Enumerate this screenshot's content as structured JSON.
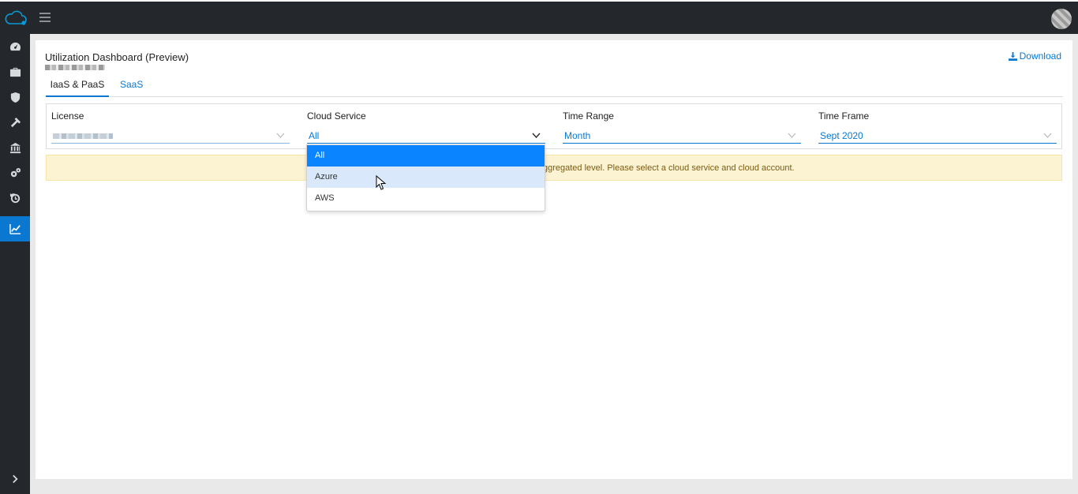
{
  "header": {
    "logo_icon": "cloud-logo-icon",
    "menu_icon": "hamburger-icon",
    "avatar": "user-avatar"
  },
  "sidebar": {
    "items": [
      {
        "name": "dashboard",
        "icon": "dashboard-icon"
      },
      {
        "name": "briefcase",
        "icon": "briefcase-icon"
      },
      {
        "name": "security",
        "icon": "shield-icon"
      },
      {
        "name": "tools",
        "icon": "hammer-icon"
      },
      {
        "name": "institution",
        "icon": "bank-icon"
      },
      {
        "name": "settings",
        "icon": "gears-icon"
      },
      {
        "name": "history",
        "icon": "history-icon"
      },
      {
        "name": "analytics",
        "icon": "chart-line-icon",
        "active": true
      }
    ],
    "expand_icon": "chevron-right-icon"
  },
  "page": {
    "title": "Utilization Dashboard (Preview)",
    "download_label": "Download"
  },
  "tabs": [
    {
      "label": "IaaS & PaaS",
      "active": true
    },
    {
      "label": "SaaS",
      "active": false
    }
  ],
  "filters": {
    "license": {
      "label": "License",
      "value": ""
    },
    "cloud_service": {
      "label": "Cloud Service",
      "value": "All"
    },
    "time_range": {
      "label": "Time Range",
      "value": "Month"
    },
    "time_frame": {
      "label": "Time Frame",
      "value": "Sept 2020"
    }
  },
  "warning": {
    "visible_text": "ggregated level. Please select a cloud service and cloud account."
  },
  "dropdown": {
    "options": [
      "All",
      "Azure",
      "AWS"
    ],
    "selected": "All",
    "hovered": "Azure"
  },
  "colors": {
    "accent": "#0a78d1",
    "topbar": "#24282c",
    "warning_bg": "#fcf3d3",
    "selected_option": "#0a84ff",
    "hover_option": "#d9e9fb"
  }
}
